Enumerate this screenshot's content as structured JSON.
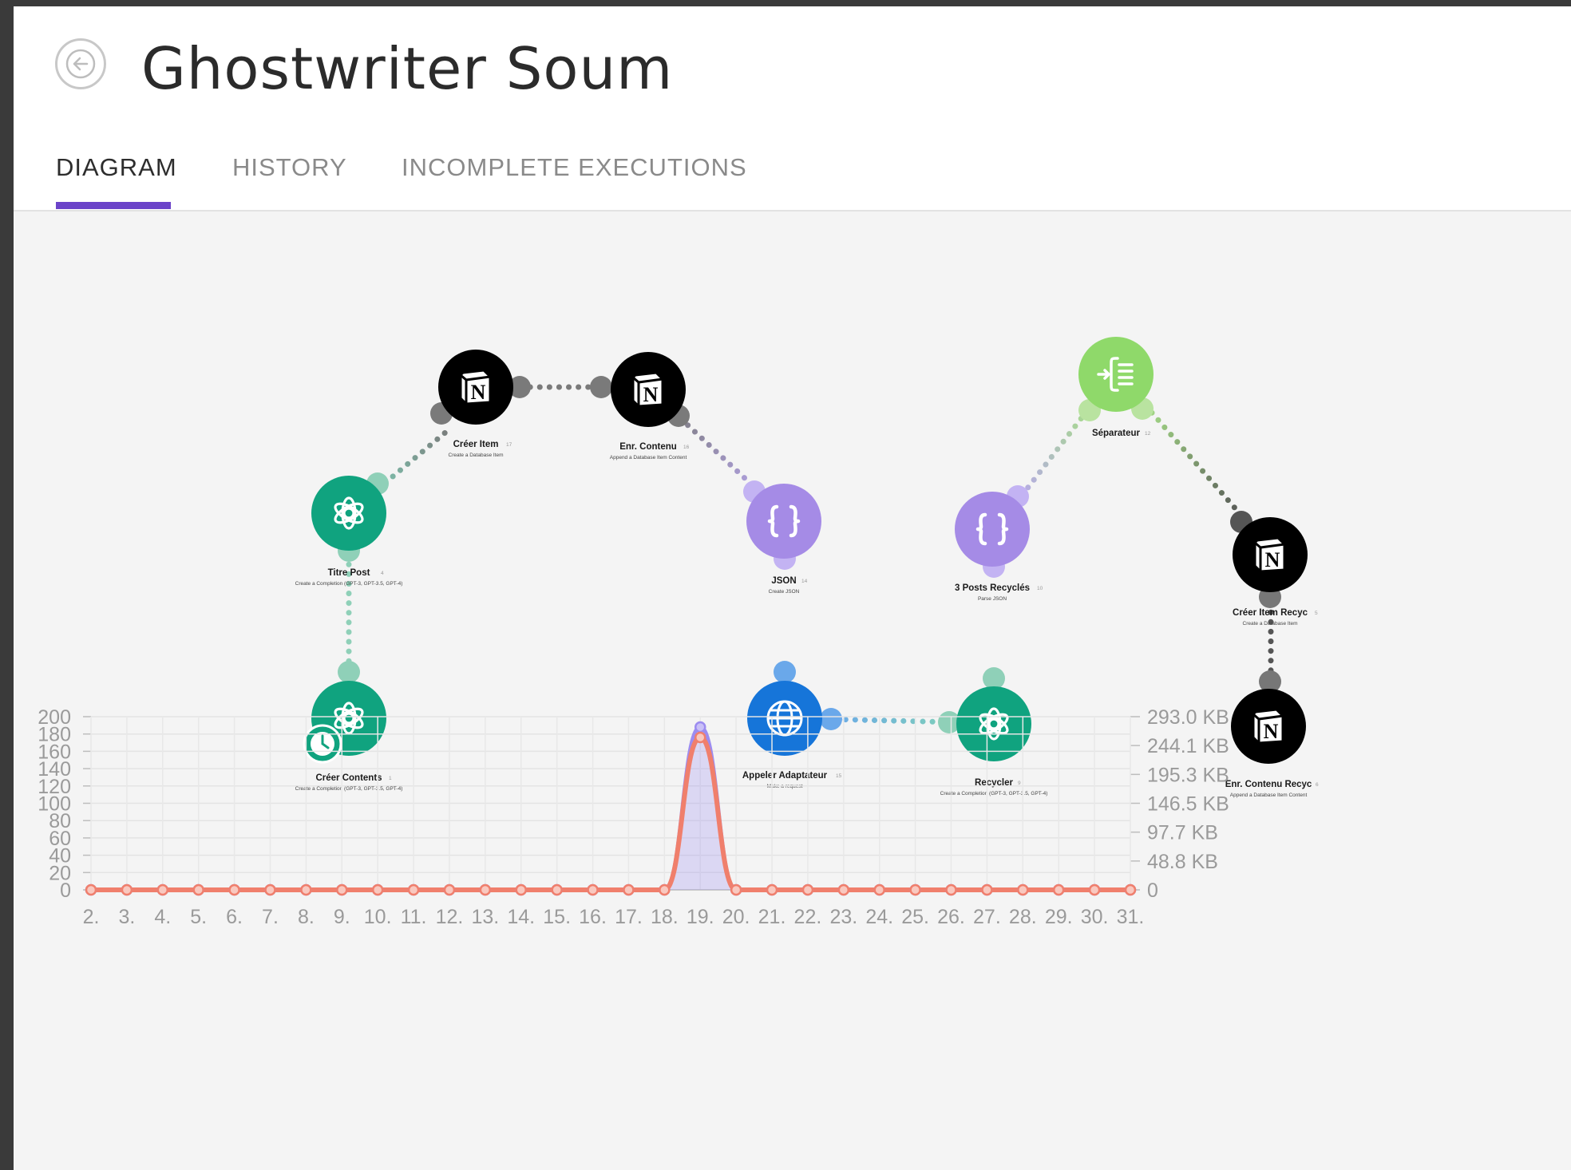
{
  "header": {
    "title": "Ghostwriter Soum",
    "back_icon": "arrow-left-icon"
  },
  "tabs": [
    {
      "label": "DIAGRAM",
      "active": true
    },
    {
      "label": "HISTORY",
      "active": false
    },
    {
      "label": "INCOMPLETE EXECUTIONS",
      "active": false
    }
  ],
  "colors": {
    "accent": "#6b43c9",
    "openai": "#10a37f",
    "notion": "#000000",
    "json": "#a58be6",
    "http": "#1675d9",
    "iterator": "#8fd96a",
    "operations_line": "#9c8cf0",
    "data_line": "#f07f6c"
  },
  "nodes": [
    {
      "id": "titre-post",
      "label": "Titre Post",
      "num": "4",
      "sub": "Create a Completion (GPT-3, GPT-3.5, GPT-4)",
      "icon": "openai-icon"
    },
    {
      "id": "creer-item",
      "label": "Créer Item",
      "num": "17",
      "sub": "Create a Database Item",
      "icon": "notion-icon"
    },
    {
      "id": "enr-contenu",
      "label": "Enr. Contenu",
      "num": "16",
      "sub": "Append a Database Item Content",
      "icon": "notion-icon"
    },
    {
      "id": "json",
      "label": "JSON",
      "num": "14",
      "sub": "Create JSON",
      "icon": "json-icon"
    },
    {
      "id": "creer-contents",
      "label": "Créer Contents",
      "num": "1",
      "sub": "Create a Completion (GPT-3, GPT-3.5, GPT-4)",
      "icon": "openai-icon"
    },
    {
      "id": "appeler-adaptateur",
      "label": "Appeler Adaptateur",
      "num": "15",
      "sub": "Make a request",
      "icon": "globe-icon"
    },
    {
      "id": "recycler",
      "label": "Recycler",
      "num": "9",
      "sub": "Create a Completion (GPT-3, GPT-3.5, GPT-4)",
      "icon": "openai-icon"
    },
    {
      "id": "posts-recycles",
      "label": "3 Posts Recyclés",
      "num": "10",
      "sub": "Parse JSON",
      "icon": "json-icon"
    },
    {
      "id": "separateur",
      "label": "Séparateur",
      "num": "12",
      "sub": "",
      "icon": "iterator-icon"
    },
    {
      "id": "creer-item-recyc",
      "label": "Créer Item Recyc",
      "num": "5",
      "sub": "Create a Database Item",
      "icon": "notion-icon"
    },
    {
      "id": "enr-contenu-recyc",
      "label": "Enr. Contenu Recyc",
      "num": "6",
      "sub": "Append a Database Item Content",
      "icon": "notion-icon"
    }
  ],
  "chart_data": {
    "type": "line",
    "title": "",
    "x": [
      "2.",
      "3.",
      "4.",
      "5.",
      "6.",
      "7.",
      "8.",
      "9.",
      "10.",
      "11.",
      "12.",
      "13.",
      "14.",
      "15.",
      "16.",
      "17.",
      "18.",
      "19.",
      "20.",
      "21.",
      "22.",
      "23.",
      "24.",
      "25.",
      "26.",
      "27.",
      "28.",
      "29.",
      "30.",
      "31."
    ],
    "y_left_ticks": [
      "0",
      "20",
      "40",
      "60",
      "80",
      "100",
      "120",
      "140",
      "160",
      "180",
      "200"
    ],
    "y_right_ticks": [
      "0",
      "48.8 KB",
      "97.7 KB",
      "146.5 KB",
      "195.3 KB",
      "244.1 KB",
      "293.0 KB"
    ],
    "ylim_left": [
      0,
      200
    ],
    "ylim_right_kb": [
      0,
      293.0
    ],
    "grid": true,
    "series": [
      {
        "values": [
          0,
          0,
          0,
          0,
          0,
          0,
          0,
          0,
          0,
          0,
          0,
          0,
          0,
          0,
          0,
          0,
          0,
          188,
          0,
          0,
          0,
          0,
          0,
          0,
          0,
          0,
          0,
          0,
          0,
          0
        ],
        "color": "#9c8cf0",
        "axis": "left",
        "fill": true
      },
      {
        "values": [
          0,
          0,
          0,
          0,
          0,
          0,
          0,
          0,
          0,
          0,
          0,
          0,
          0,
          0,
          0,
          0,
          0,
          176,
          0,
          0,
          0,
          0,
          0,
          0,
          0,
          0,
          0,
          0,
          0,
          0
        ],
        "color": "#f07f6c",
        "axis": "left",
        "fill": false
      }
    ]
  }
}
